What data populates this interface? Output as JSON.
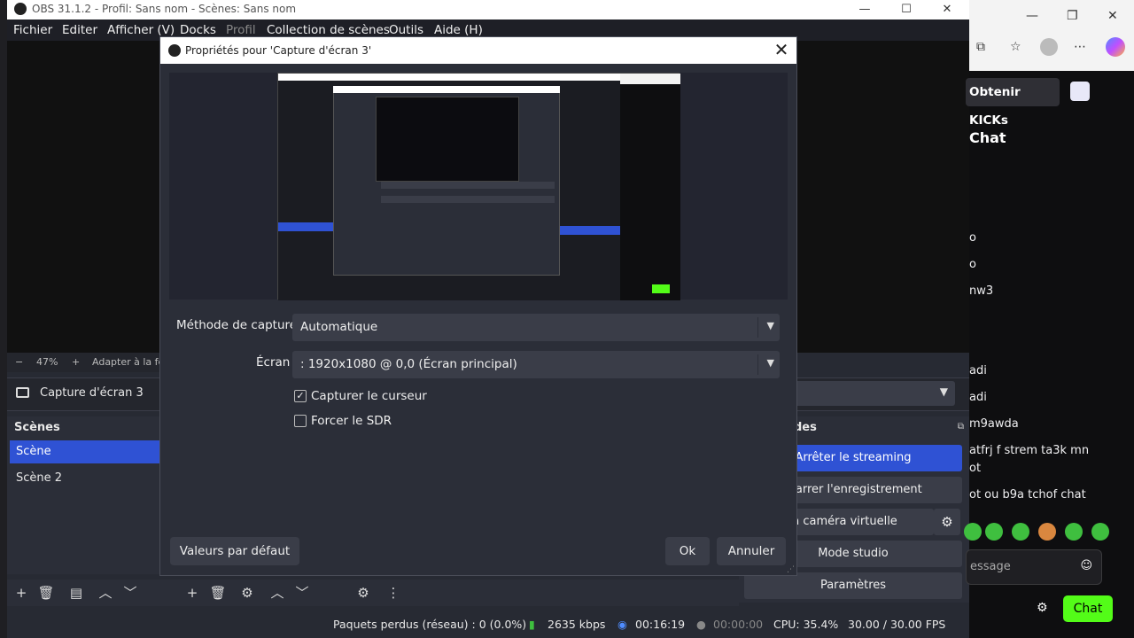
{
  "obs": {
    "title": "OBS 31.1.2 - Profil: Sans nom - Scènes: Sans nom",
    "menu": [
      "Fichier",
      "Editer",
      "Afficher (V)",
      "Docks",
      "Profil",
      "Collection de scènes",
      "Outils",
      "Aide (H)"
    ],
    "zoom": {
      "minus": "−",
      "value": "47%",
      "plus": "+",
      "fit": "Adapter à la fe"
    },
    "source_name": "Capture d'écran 3",
    "scenes": {
      "header": "Scènes",
      "items": [
        "Scène",
        "Scène 2"
      ]
    },
    "controls": {
      "header": "des",
      "buttons": [
        "Arrêter le streaming",
        "marrer l'enregistrement",
        "r la caméra virtuelle",
        "Mode studio",
        "Paramètres"
      ]
    },
    "status": {
      "dropped": "Paquets perdus (réseau) : 0 (0.0%)",
      "bitrate": "2635 kbps",
      "stream_time": "00:16:19",
      "rec_time": "00:00:00",
      "cpu": "CPU: 35.4%",
      "fps": "30.00 / 30.00 FPS"
    },
    "colors": {
      "accent": "#2f52d4",
      "panel": "#2b2e38",
      "button": "#3a3d48"
    }
  },
  "dialog": {
    "title": "Propriétés pour 'Capture d'écran 3'",
    "capture_method_label": "Méthode de capture",
    "capture_method_value": "Automatique",
    "screen_label": "Écran",
    "screen_value": ": 1920x1080 @ 0,0 (Écran principal)",
    "capture_cursor": {
      "label": "Capturer le curseur",
      "checked": true
    },
    "force_sdr": {
      "label": "Forcer le SDR",
      "checked": false
    },
    "defaults_button": "Valeurs par défaut",
    "ok_button": "Ok",
    "cancel_button": "Annuler"
  },
  "browser": {
    "kicks_button": "Obtenir KICKs",
    "chat_header": "Chat",
    "chat_lines": [
      "o",
      "o",
      "nw3",
      "adi",
      "adi",
      "m9awda",
      "atfrj f strem ta3k mn",
      "ot",
      "ot ou b9a tchof chat"
    ],
    "input_placeholder": "essage",
    "send_label": "Chat",
    "accent": "#53fc18"
  }
}
